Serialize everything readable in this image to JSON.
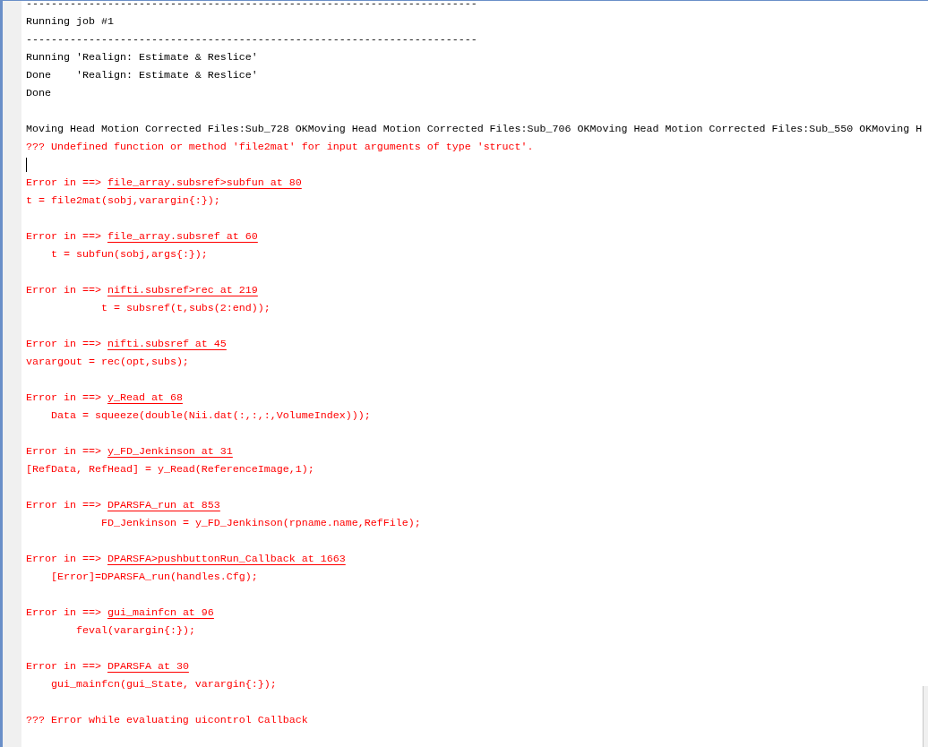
{
  "console": {
    "lines": [
      {
        "kind": "text",
        "text": "------------------------------------------------------------------------"
      },
      {
        "kind": "text",
        "text": "Running job #1"
      },
      {
        "kind": "text",
        "text": "------------------------------------------------------------------------"
      },
      {
        "kind": "text",
        "text": "Running 'Realign: Estimate & Reslice'"
      },
      {
        "kind": "text",
        "text": "Done    'Realign: Estimate & Reslice'"
      },
      {
        "kind": "text",
        "text": "Done"
      },
      {
        "kind": "blank"
      },
      {
        "kind": "text",
        "text": "Moving Head Motion Corrected Files:Sub_728 OKMoving Head Motion Corrected Files:Sub_706 OKMoving Head Motion Corrected Files:Sub_550 OKMoving H"
      },
      {
        "kind": "error",
        "text": "??? Undefined function or method 'file2mat' for input arguments of type 'struct'."
      },
      {
        "kind": "cursor"
      },
      {
        "kind": "trace",
        "text": "Error in ==> ",
        "link": "file_array.subsref>subfun at 80"
      },
      {
        "kind": "error",
        "text": "t = file2mat(sobj,varargin{:});"
      },
      {
        "kind": "blank"
      },
      {
        "kind": "trace",
        "text": "Error in ==> ",
        "link": "file_array.subsref at 60"
      },
      {
        "kind": "error",
        "text": "    t = subfun(sobj,args{:});"
      },
      {
        "kind": "blank"
      },
      {
        "kind": "trace",
        "text": "Error in ==> ",
        "link": "nifti.subsref>rec at 219"
      },
      {
        "kind": "error",
        "text": "            t = subsref(t,subs(2:end));"
      },
      {
        "kind": "blank"
      },
      {
        "kind": "trace",
        "text": "Error in ==> ",
        "link": "nifti.subsref at 45"
      },
      {
        "kind": "error",
        "text": "varargout = rec(opt,subs);"
      },
      {
        "kind": "blank"
      },
      {
        "kind": "trace",
        "text": "Error in ==> ",
        "link": "y_Read at 68"
      },
      {
        "kind": "error",
        "text": "    Data = squeeze(double(Nii.dat(:,:,:,VolumeIndex)));"
      },
      {
        "kind": "blank"
      },
      {
        "kind": "trace",
        "text": "Error in ==> ",
        "link": "y_FD_Jenkinson at 31"
      },
      {
        "kind": "error",
        "text": "[RefData, RefHead] = y_Read(ReferenceImage,1);"
      },
      {
        "kind": "blank"
      },
      {
        "kind": "trace",
        "text": "Error in ==> ",
        "link": "DPARSFA_run at 853"
      },
      {
        "kind": "error",
        "text": "            FD_Jenkinson = y_FD_Jenkinson(rpname.name,RefFile);"
      },
      {
        "kind": "blank"
      },
      {
        "kind": "trace",
        "text": "Error in ==> ",
        "link": "DPARSFA>pushbuttonRun_Callback at 1663"
      },
      {
        "kind": "error",
        "text": "    [Error]=DPARSFA_run(handles.Cfg);"
      },
      {
        "kind": "blank"
      },
      {
        "kind": "trace",
        "text": "Error in ==> ",
        "link": "gui_mainfcn at 96"
      },
      {
        "kind": "error",
        "text": "        feval(varargin{:});"
      },
      {
        "kind": "blank"
      },
      {
        "kind": "trace",
        "text": "Error in ==> ",
        "link": "DPARSFA at 30"
      },
      {
        "kind": "error",
        "text": "    gui_mainfcn(gui_State, varargin{:});"
      },
      {
        "kind": "blank"
      },
      {
        "kind": "error",
        "text": "??? Error while evaluating uicontrol Callback"
      }
    ]
  }
}
